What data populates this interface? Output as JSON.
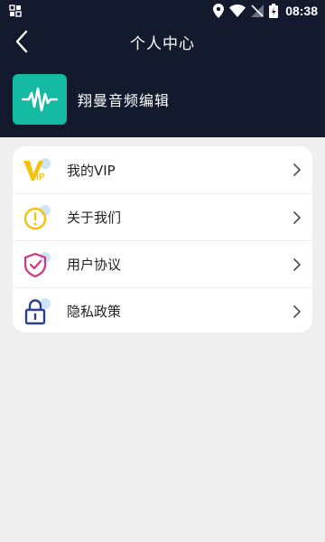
{
  "status_bar": {
    "time": "08:38",
    "icons": [
      "notification-icon",
      "location-icon",
      "wifi-icon",
      "no-signal-icon",
      "battery-icon"
    ]
  },
  "navbar": {
    "title": "个人中心",
    "back_icon": "back-arrow-icon"
  },
  "app": {
    "name": "翔曼音频编辑",
    "logo_icon": "waveform-icon",
    "logo_color": "#13b9a0"
  },
  "menu": {
    "items": [
      {
        "label": "我的VIP",
        "icon": "vip-icon"
      },
      {
        "label": "关于我们",
        "icon": "info-icon"
      },
      {
        "label": "用户协议",
        "icon": "shield-check-icon"
      },
      {
        "label": "隐私政策",
        "icon": "lock-icon"
      }
    ]
  },
  "colors": {
    "header_bg": "#141a2e",
    "page_bg": "#efefef",
    "card_bg": "#ffffff",
    "vip_yellow": "#f4c20d",
    "shield_pink": "#d6337a",
    "lock_blue": "#2d3f8f",
    "bubble_blue": "#cfe3f7"
  }
}
